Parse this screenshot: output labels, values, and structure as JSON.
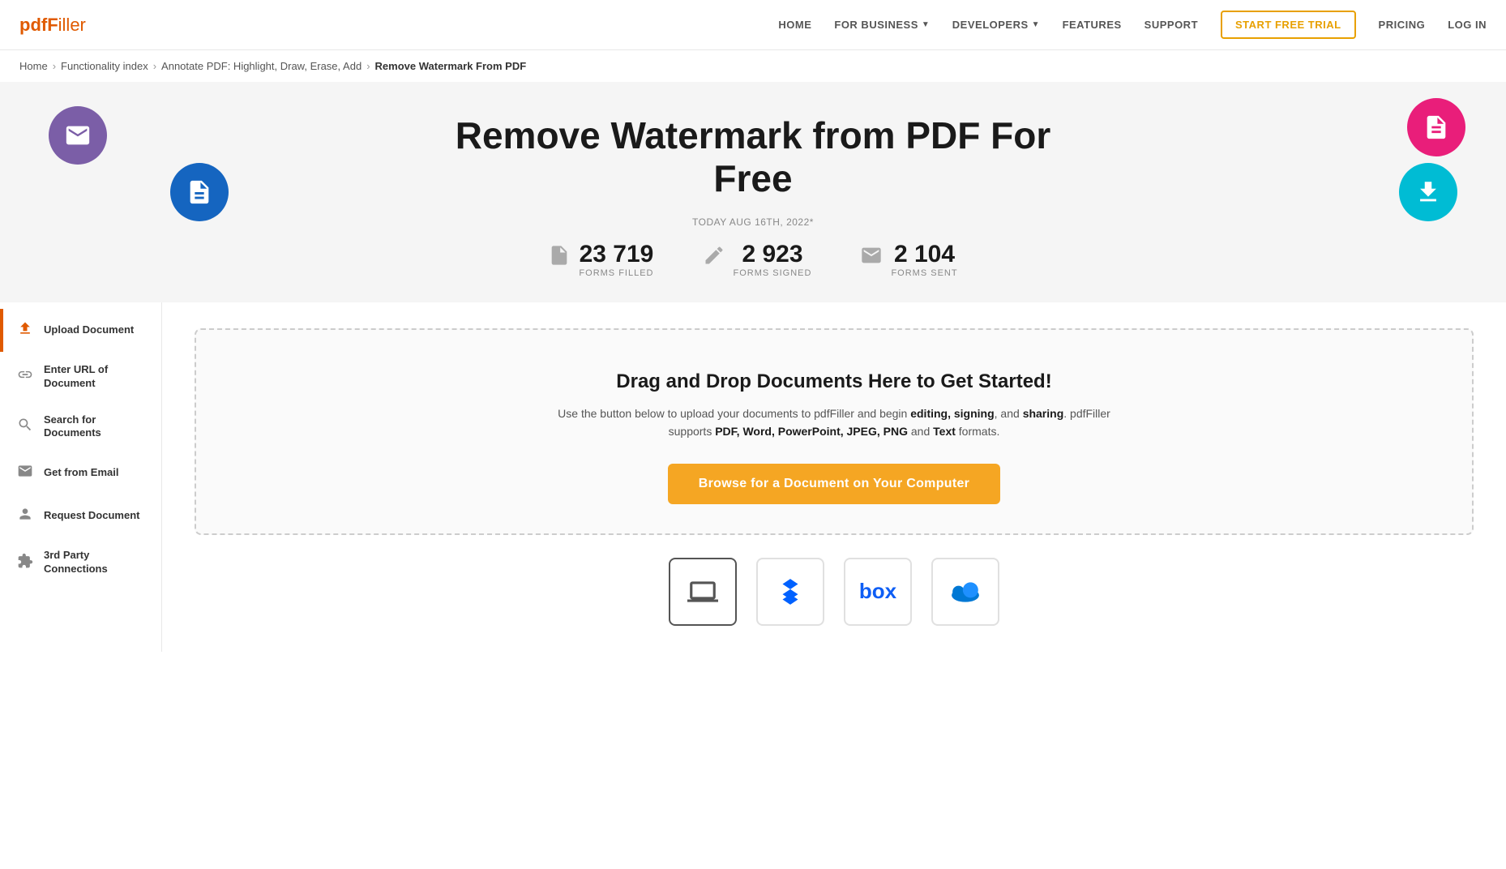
{
  "brand": {
    "logo_pdf": "pdf",
    "logo_filler": "Filler"
  },
  "navbar": {
    "links": [
      {
        "id": "home",
        "label": "HOME"
      },
      {
        "id": "for-business",
        "label": "FOR BUSINESS",
        "dropdown": true
      },
      {
        "id": "developers",
        "label": "DEVELOPERS",
        "dropdown": true
      },
      {
        "id": "features",
        "label": "FEATURES"
      },
      {
        "id": "support",
        "label": "SUPPORT"
      }
    ],
    "cta_label": "START FREE TRIAL",
    "login_label": "LOG IN",
    "pricing_label": "PRICING"
  },
  "breadcrumb": {
    "items": [
      {
        "label": "Home",
        "url": "#"
      },
      {
        "label": "Functionality index",
        "url": "#"
      },
      {
        "label": "Annotate PDF: Highlight, Draw, Erase, Add",
        "url": "#"
      }
    ],
    "current": "Remove Watermark From PDF"
  },
  "hero": {
    "title_line1": "Remove Watermark from PDF For",
    "title_line2": "Free",
    "date_label": "TODAY AUG 16TH, 2022*",
    "stats": [
      {
        "id": "forms-filled",
        "number": "23 719",
        "label": "FORMS FILLED",
        "icon": "📄"
      },
      {
        "id": "forms-signed",
        "number": "2 923",
        "label": "FORMS SIGNED",
        "icon": "✍️"
      },
      {
        "id": "forms-sent",
        "number": "2 104",
        "label": "FORMS SENT",
        "icon": "✉️"
      }
    ]
  },
  "sidebar": {
    "items": [
      {
        "id": "upload-document",
        "label": "Upload Document",
        "icon": "⬆",
        "active": true
      },
      {
        "id": "enter-url",
        "label": "Enter URL of Document",
        "icon": "🔗",
        "active": false
      },
      {
        "id": "search-documents",
        "label": "Search for Documents",
        "icon": "🔍",
        "active": false
      },
      {
        "id": "get-from-email",
        "label": "Get from Email",
        "icon": "✉",
        "active": false
      },
      {
        "id": "request-document",
        "label": "Request Document",
        "icon": "👤",
        "active": false
      },
      {
        "id": "third-party",
        "label": "3rd Party Connections",
        "icon": "🔌",
        "active": false
      }
    ]
  },
  "upload_zone": {
    "title": "Drag and Drop Documents Here to Get Started!",
    "description_prefix": "Use the button below to upload your documents to pdfFiller and begin ",
    "description_bold1": "editing, signing",
    "description_middle": ", and ",
    "description_bold2": "sharing",
    "description_suffix1": ". pdfFiller supports ",
    "description_bold3": "PDF, Word, PowerPoint, JPEG, PNG",
    "description_suffix2": " and ",
    "description_bold4": "Text",
    "description_suffix3": " formats.",
    "browse_button": "Browse for a Document on Your Computer"
  },
  "cloud_sources": [
    {
      "id": "computer",
      "label": "Computer",
      "icon": "laptop"
    },
    {
      "id": "dropbox",
      "label": "Dropbox",
      "icon": "dropbox"
    },
    {
      "id": "box",
      "label": "Box",
      "icon": "box"
    },
    {
      "id": "onedrive",
      "label": "OneDrive",
      "icon": "onedrive"
    }
  ],
  "colors": {
    "accent": "#e05a00",
    "cta_btn": "#f5a623",
    "purple_circle": "#7b5ea7",
    "blue_circle": "#1565c0",
    "pink_circle": "#e91e7a",
    "cyan_circle": "#00bcd4"
  }
}
